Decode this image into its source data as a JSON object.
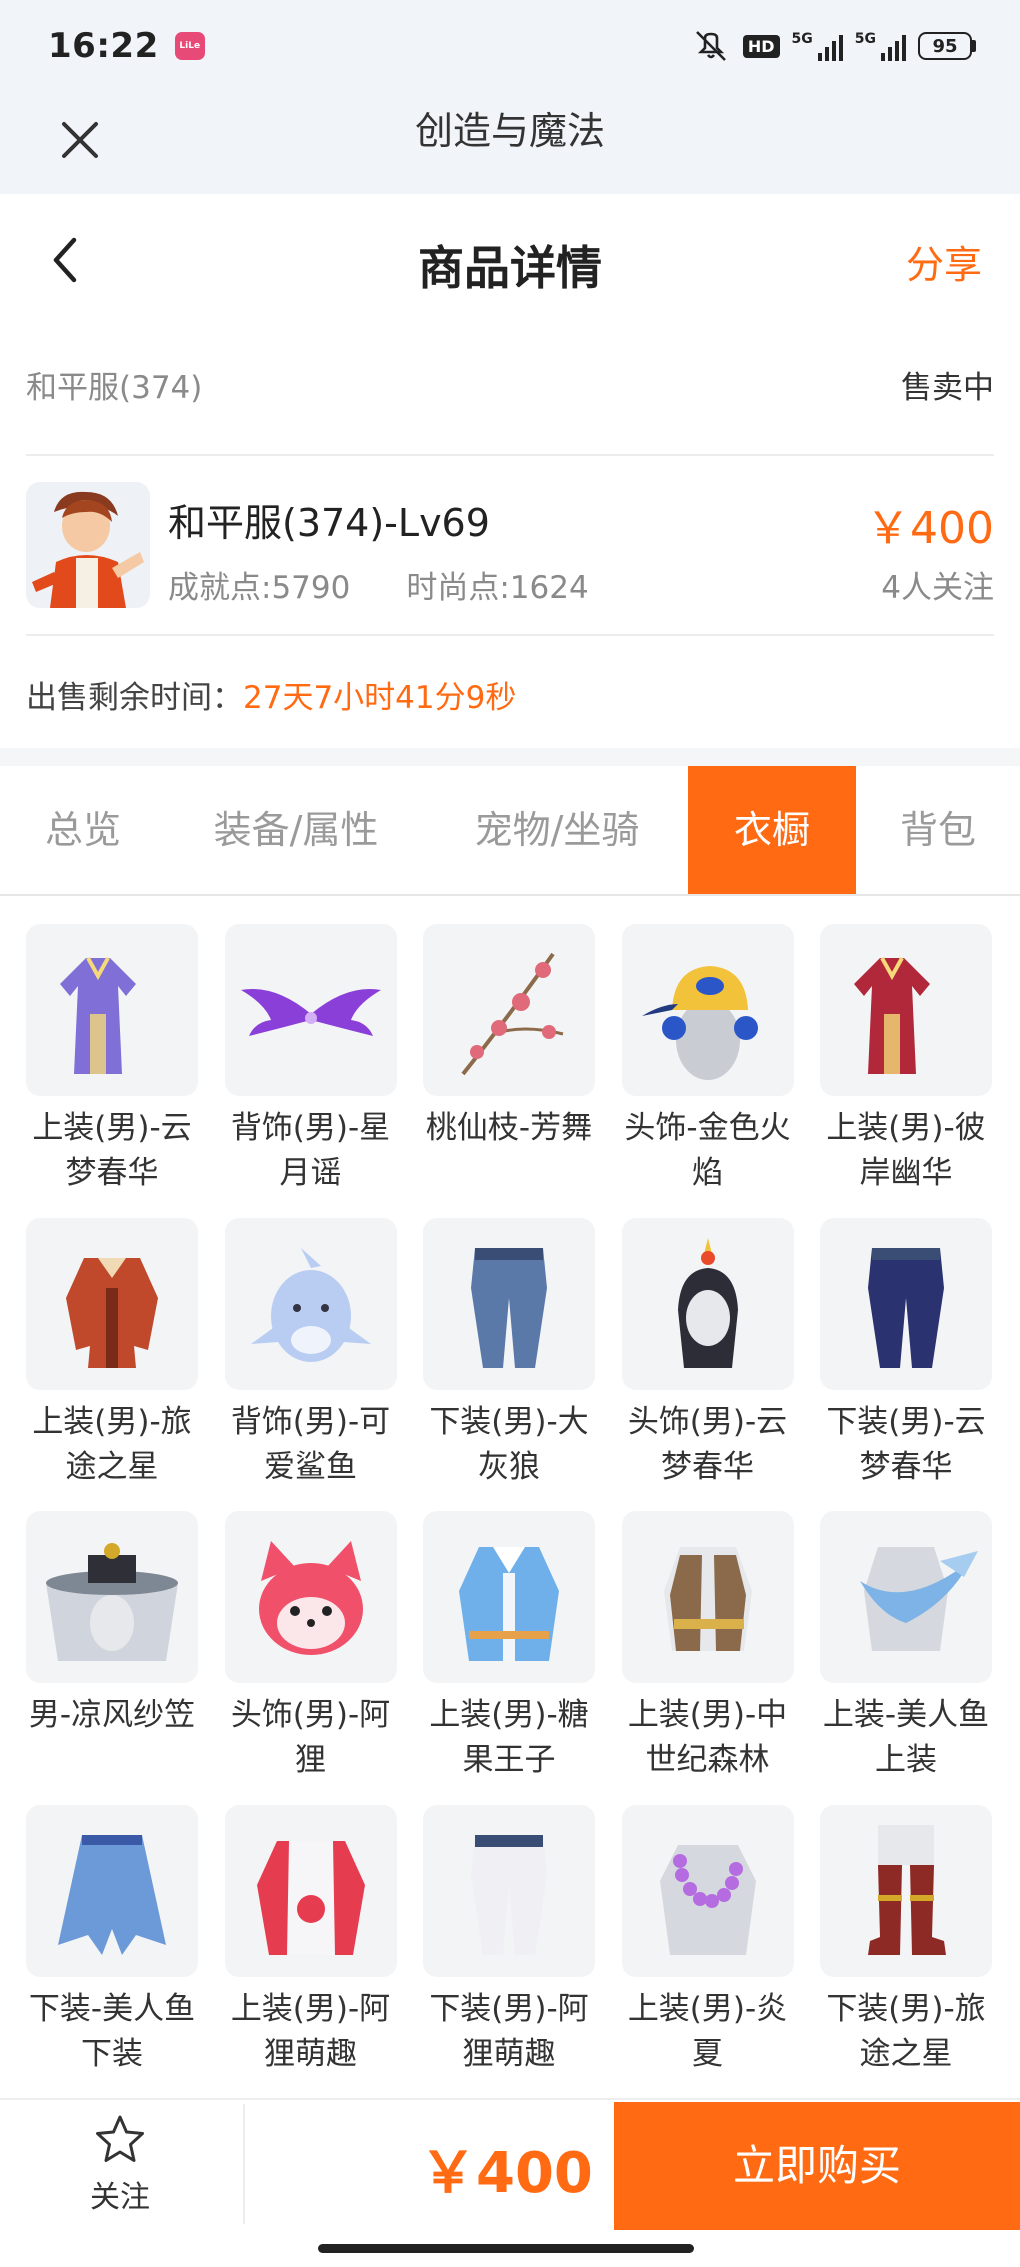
{
  "status_bar": {
    "time": "16:22",
    "app_badge": "LiLe",
    "hd_label": "HD",
    "network_1": "5G",
    "network_2": "5G",
    "battery": "95"
  },
  "window": {
    "title": "创造与魔法"
  },
  "nav": {
    "title": "商品详情",
    "share_label": "分享"
  },
  "listing": {
    "server": "和平服(374)",
    "status": "售卖中",
    "name": "和平服(374)-Lv69",
    "achievement": "成就点:5790",
    "fashion": "时尚点:1624",
    "price": "￥400",
    "followers": "4人关注",
    "timer_label": "出售剩余时间：",
    "timer_value": "27天7小时41分9秒"
  },
  "tabs": [
    {
      "label": "总览",
      "active": false
    },
    {
      "label": "装备/属性",
      "active": false
    },
    {
      "label": "宠物/坐骑",
      "active": false
    },
    {
      "label": "衣橱",
      "active": true
    },
    {
      "label": "背包",
      "active": false
    }
  ],
  "wardrobe": [
    {
      "name": "上装(男)-云梦春华",
      "icon": "robe-icon",
      "color": "#7f6fd6"
    },
    {
      "name": "背饰(男)-星月谣",
      "icon": "wings-icon",
      "color": "#8b3fd9"
    },
    {
      "name": "桃仙枝-芳舞",
      "icon": "branch-icon",
      "color": "#e06a7a"
    },
    {
      "name": "头饰-金色火焰",
      "icon": "cap-icon",
      "color": "#f2c23a"
    },
    {
      "name": "上装(男)-彼岸幽华",
      "icon": "robe-icon",
      "color": "#b0283a"
    },
    {
      "name": "上装(男)-旅途之星",
      "icon": "jacket-icon",
      "color": "#c0492b"
    },
    {
      "name": "背饰(男)-可爱鲨鱼",
      "icon": "shark-icon",
      "color": "#b9cdf2"
    },
    {
      "name": "下装(男)-大灰狼",
      "icon": "pants-icon",
      "color": "#5a78a8"
    },
    {
      "name": "头饰(男)-云梦春华",
      "icon": "headdress-icon",
      "color": "#2d2d38"
    },
    {
      "name": "下装(男)-云梦春华",
      "icon": "pants-icon",
      "color": "#2a3270"
    },
    {
      "name": "男-凉风纱笠",
      "icon": "hat-icon",
      "color": "#7e8894"
    },
    {
      "name": "头饰(男)-阿狸",
      "icon": "fox-icon",
      "color": "#f0506a"
    },
    {
      "name": "上装(男)-糖果王子",
      "icon": "coat-icon",
      "color": "#6fb0ea"
    },
    {
      "name": "上装(男)-中世纪森林",
      "icon": "vest-icon",
      "color": "#8a6a4a"
    },
    {
      "name": "上装-美人鱼上装",
      "icon": "shawl-icon",
      "color": "#7db3e6"
    },
    {
      "name": "下装-美人鱼下装",
      "icon": "skirt-icon",
      "color": "#6c9ad8"
    },
    {
      "name": "上装(男)-阿狸萌趣",
      "icon": "hoodie-icon",
      "color": "#e63c50"
    },
    {
      "name": "下装(男)-阿狸萌趣",
      "icon": "pants-icon",
      "color": "#f0f0f4"
    },
    {
      "name": "上装(男)-炎夏",
      "icon": "lei-icon",
      "color": "#b56ce0"
    },
    {
      "name": "下装(男)-旅途之星",
      "icon": "boots-icon",
      "color": "#8e2a26"
    }
  ],
  "bottom": {
    "follow_label": "关注",
    "price": "￥400",
    "buy_label": "立即购买"
  },
  "colors": {
    "accent": "#ff6a13",
    "header_bg": "#f1f4f8",
    "thumb_bg": "#f3f4f6"
  }
}
